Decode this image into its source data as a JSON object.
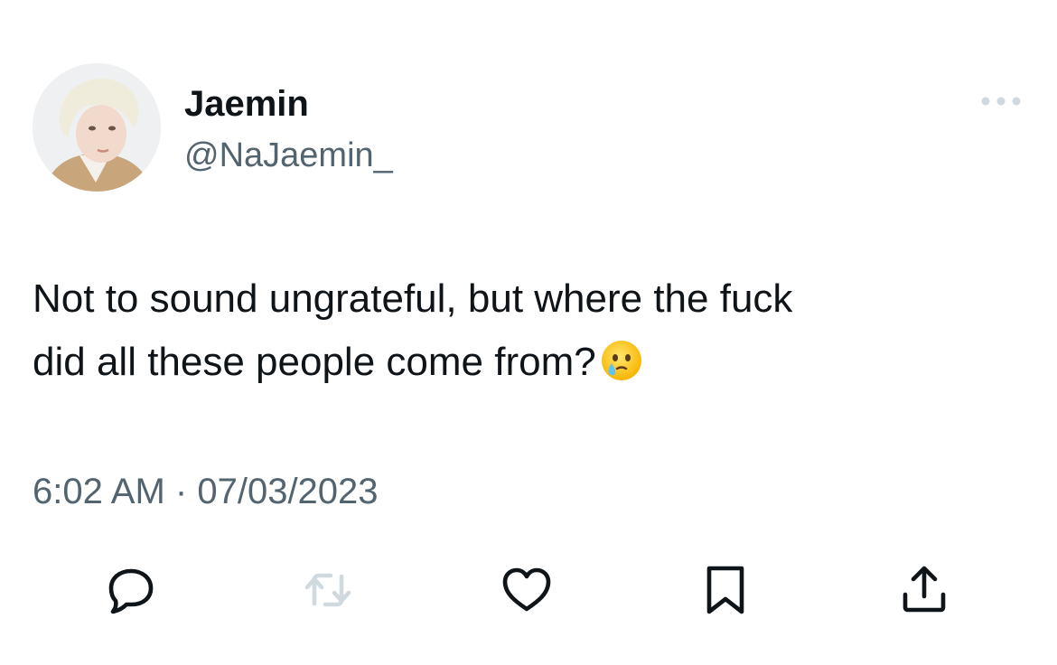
{
  "author": {
    "display_name": "Jaemin",
    "handle": "@NaJaemin_"
  },
  "tweet": {
    "text_line_1": "Not to sound ungrateful, but where the fuck",
    "text_line_2": "did all these people come from?",
    "emoji": "face-holding-back-tears",
    "time": "6:02 AM",
    "separator": "·",
    "date": "07/03/2023"
  },
  "icons": {
    "more": "more-icon",
    "reply": "reply-icon",
    "retweet": "retweet-icon",
    "like": "heart-icon",
    "bookmark": "bookmark-icon",
    "share": "share-icon"
  },
  "colors": {
    "text_primary": "#0f1419",
    "text_secondary": "#536471",
    "icon_muted": "#cfd9de",
    "background": "#ffffff"
  }
}
